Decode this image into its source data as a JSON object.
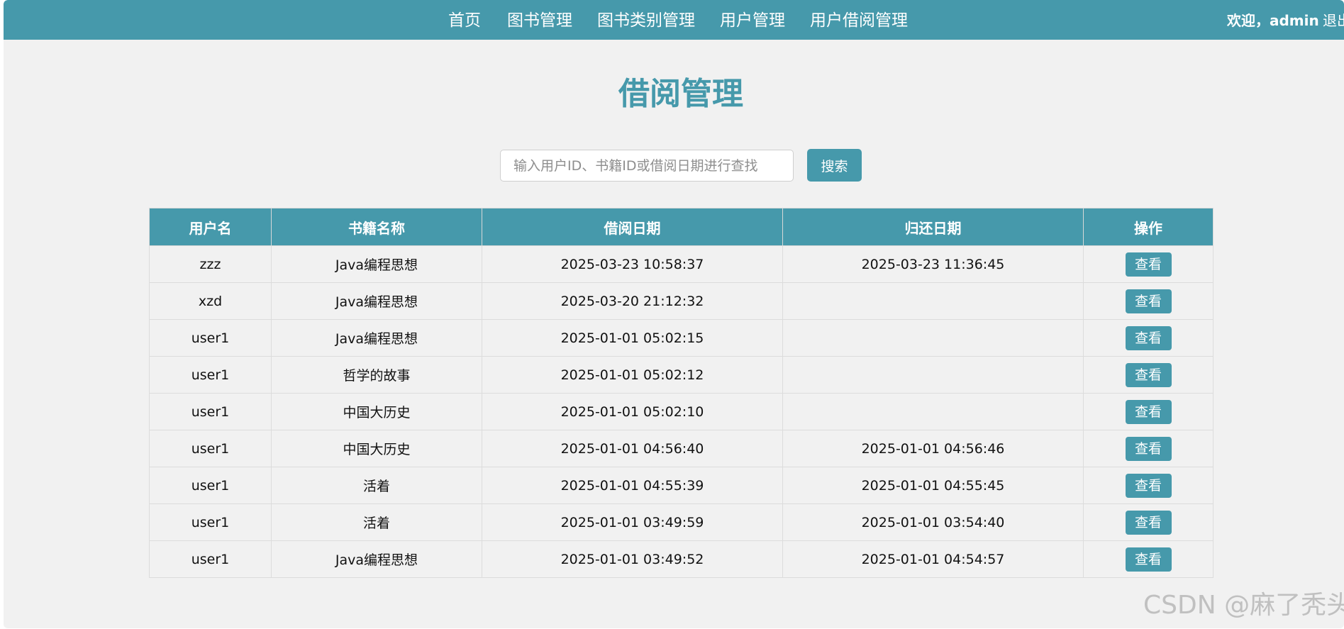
{
  "nav": {
    "items": [
      {
        "label": "首页"
      },
      {
        "label": "图书管理"
      },
      {
        "label": "图书类别管理"
      },
      {
        "label": "用户管理"
      },
      {
        "label": "用户借阅管理"
      }
    ],
    "welcome": "欢迎，admin",
    "logout": "退出"
  },
  "page": {
    "title": "借阅管理"
  },
  "search": {
    "placeholder": "输入用户ID、书籍ID或借阅日期进行查找",
    "value": "",
    "button_label": "搜索"
  },
  "table": {
    "columns": [
      "用户名",
      "书籍名称",
      "借阅日期",
      "归还日期",
      "操作"
    ],
    "action_label": "查看",
    "rows": [
      {
        "user": "zzz",
        "book": "Java编程思想",
        "borrow_date": "2025-03-23 10:58:37",
        "return_date": "2025-03-23 11:36:45"
      },
      {
        "user": "xzd",
        "book": "Java编程思想",
        "borrow_date": "2025-03-20 21:12:32",
        "return_date": ""
      },
      {
        "user": "user1",
        "book": "Java编程思想",
        "borrow_date": "2025-01-01 05:02:15",
        "return_date": ""
      },
      {
        "user": "user1",
        "book": "哲学的故事",
        "borrow_date": "2025-01-01 05:02:12",
        "return_date": ""
      },
      {
        "user": "user1",
        "book": "中国大历史",
        "borrow_date": "2025-01-01 05:02:10",
        "return_date": ""
      },
      {
        "user": "user1",
        "book": "中国大历史",
        "borrow_date": "2025-01-01 04:56:40",
        "return_date": "2025-01-01 04:56:46"
      },
      {
        "user": "user1",
        "book": "活着",
        "borrow_date": "2025-01-01 04:55:39",
        "return_date": "2025-01-01 04:55:45"
      },
      {
        "user": "user1",
        "book": "活着",
        "borrow_date": "2025-01-01 03:49:59",
        "return_date": "2025-01-01 03:54:40"
      },
      {
        "user": "user1",
        "book": "Java编程思想",
        "borrow_date": "2025-01-01 03:49:52",
        "return_date": "2025-01-01 04:54:57"
      }
    ]
  },
  "watermark": "CSDN @麻了秃头",
  "colors": {
    "accent": "#4699ab",
    "background": "#f1f1f1"
  }
}
